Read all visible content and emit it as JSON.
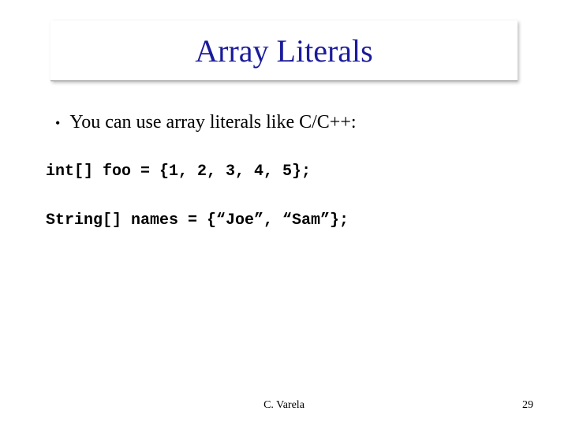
{
  "title": "Array Literals",
  "bullet": {
    "text": "You can use array literals like C/C++:"
  },
  "code_line_1": "int[] foo = {1, 2, 3, 4, 5};",
  "code_line_2": "String[] names = {“Joe”, “Sam”};",
  "footer": {
    "author": "C. Varela",
    "page": "29"
  }
}
